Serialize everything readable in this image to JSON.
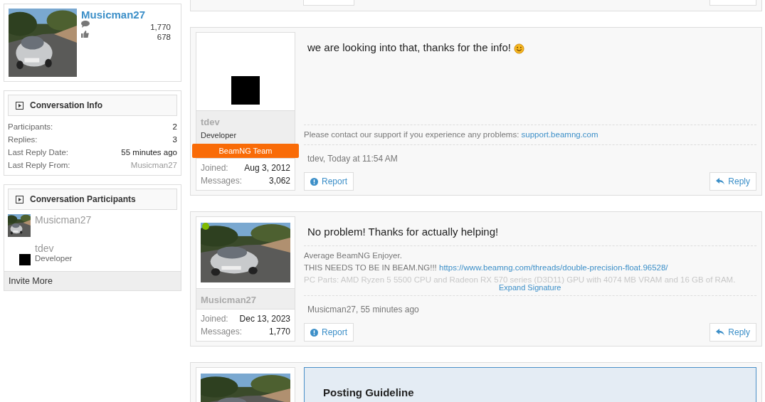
{
  "sidebar": {
    "profile": {
      "username": "Musicman27",
      "message_count": "1,770",
      "like_count": "678"
    },
    "conversation_info": {
      "title": "Conversation Info",
      "rows": [
        {
          "label": "Participants:",
          "value": "2",
          "kind": "text"
        },
        {
          "label": "Replies:",
          "value": "3",
          "kind": "text"
        },
        {
          "label": "Last Reply Date:",
          "value": "55 minutes ago",
          "kind": "text"
        },
        {
          "label": "Last Reply From:",
          "value": "Musicman27",
          "kind": "user"
        }
      ]
    },
    "participants": {
      "title": "Conversation Participants",
      "items": [
        {
          "name": "Musicman27",
          "avatar": {
            "kind": "picture"
          }
        },
        {
          "name": "tdev",
          "role": "Developer",
          "avatar": {
            "kind": "square"
          }
        }
      ],
      "invite": "Invite More"
    }
  },
  "previous_post": {
    "report_button": true,
    "reply_button": true
  },
  "posts": [
    {
      "kind": "reply",
      "avatar": {
        "kind": "square"
      },
      "online": false,
      "username": "tdev",
      "title": "Developer",
      "banner": "BeamNG Team",
      "joined_label": "Joined:",
      "joined": "Aug 3, 2012",
      "messages_label": "Messages:",
      "messages": "3,062",
      "message": "we are looking into that, thanks for the info!",
      "smiley": true,
      "signature": [
        {
          "text": "Please contact our support if you experience any problems: ",
          "link": "support.beamng.com",
          "kind": "plain"
        }
      ],
      "meta": "tdev, Today at 11:54 AM",
      "report": "Report",
      "reply": "Reply"
    },
    {
      "kind": "reply",
      "avatar": {
        "kind": "picture"
      },
      "online": true,
      "username": "Musicman27",
      "joined_label": "Joined:",
      "joined": "Dec 13, 2023",
      "messages_label": "Messages:",
      "messages": "1,770",
      "message": "No problem! Thanks for actually helping!",
      "smiley": false,
      "signature": [
        {
          "text": "Average BeamNG Enjoyer.",
          "kind": "plain"
        },
        {
          "text": "THIS NEEDS TO BE IN BEAM.NG!!! ",
          "link": "https://www.beamng.com/threads/double-precision-float.96528/",
          "kind": "plain"
        },
        {
          "text": "PC Parts: AMD Ryzen 5 5500 CPU and Radeon RX 570 series (D3D11) GPU with 4074 MB VRAM and 16 GB of RAM.",
          "kind": "faded"
        }
      ],
      "expand": "Expand Signature",
      "meta": "Musicman27, 55 minutes ago",
      "report": "Report",
      "reply": "Reply"
    },
    {
      "kind": "notice",
      "avatar": {
        "kind": "picture"
      },
      "online": false,
      "title": "Posting Guideline"
    }
  ]
}
